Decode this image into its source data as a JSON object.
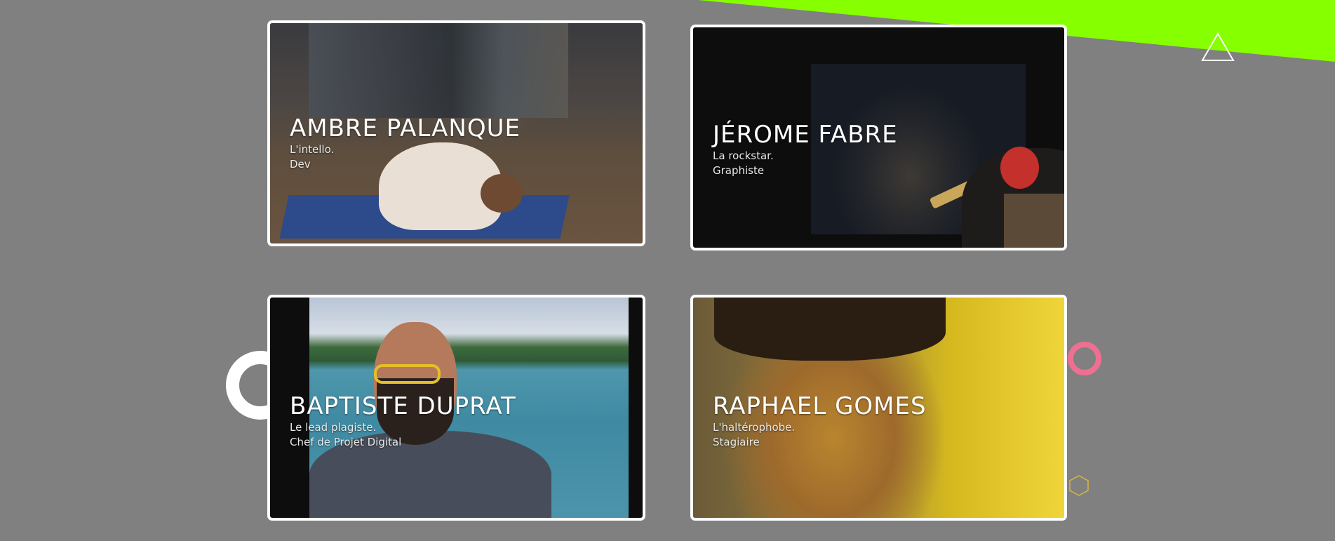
{
  "colors": {
    "background": "#808080",
    "accent_band": "#86ff00",
    "card_border": "#ffffff",
    "ring_white": "#ffffff",
    "ring_pink": "#ef6f92",
    "hexagon": "#d8b442"
  },
  "decorations": {
    "band": "green-diagonal-band",
    "icons": [
      "triangle-outline-icon",
      "white-ring-icon",
      "pink-ring-icon",
      "hexagon-outline-icon"
    ]
  },
  "team": [
    {
      "name": "AMBRE PALANQUE",
      "tagline": "L'intello.",
      "role": "Dev"
    },
    {
      "name": "JÉROME FABRE",
      "tagline": "La rockstar.",
      "role": "Graphiste"
    },
    {
      "name": "BAPTISTE DUPRAT",
      "tagline": "Le lead plagiste.",
      "role": "Chef de Projet Digital"
    },
    {
      "name": "RAPHAEL GOMES",
      "tagline": "L'haltérophobe.",
      "role": "Stagiaire"
    }
  ]
}
